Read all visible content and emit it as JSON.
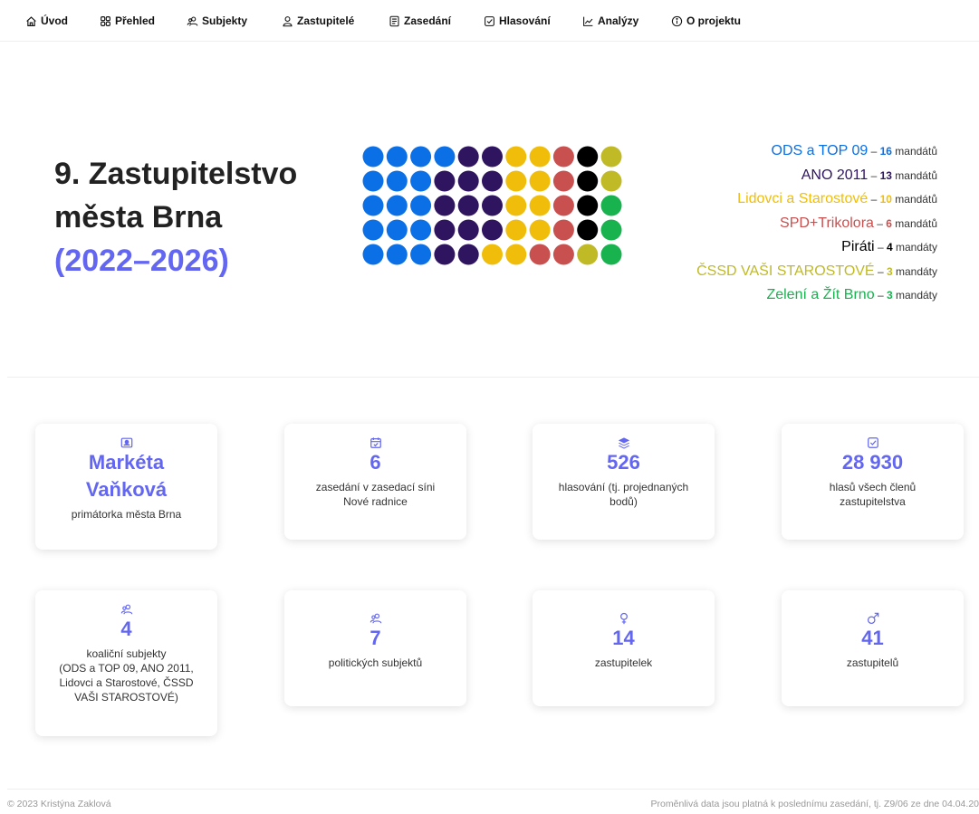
{
  "nav": {
    "items": [
      {
        "label": "Úvod",
        "icon": "home-icon"
      },
      {
        "label": "Přehled",
        "icon": "grid-icon"
      },
      {
        "label": "Subjekty",
        "icon": "users-icon"
      },
      {
        "label": "Zastupitelé",
        "icon": "user-icon"
      },
      {
        "label": "Zasedání",
        "icon": "document-icon"
      },
      {
        "label": "Hlasování",
        "icon": "checkbox-icon"
      },
      {
        "label": "Analýzy",
        "icon": "chart-icon"
      },
      {
        "label": "O projektu",
        "icon": "info-icon"
      }
    ]
  },
  "hero": {
    "title_line1": "9. Zastupitelstvo",
    "title_line2": "města Brna",
    "years": "(2022–2026)"
  },
  "parties": [
    {
      "name": "ODS a TOP 09",
      "dash": " – ",
      "count": "16",
      "unit": " mandátů",
      "color": "#0b6fe6"
    },
    {
      "name": "ANO 2011",
      "dash": " – ",
      "count": "13",
      "unit": " mandátů",
      "color": "#2f1460"
    },
    {
      "name": "Lidovci a Starostové",
      "dash": " – ",
      "count": "10",
      "unit": " mandátů",
      "color": "#f0be0a"
    },
    {
      "name": "SPD+Trikolora",
      "dash": " – ",
      "count": "6",
      "unit": " mandátů",
      "color": "#c8504f"
    },
    {
      "name": "Piráti",
      "dash": " – ",
      "count": "4",
      "unit": " mandáty",
      "color": "#000000"
    },
    {
      "name": "ČSSD VAŠI STAROSTOVÉ",
      "dash": " – ",
      "count": "3",
      "unit": " mandáty",
      "color": "#bfba25"
    },
    {
      "name": "Zelení a Žít Brno",
      "dash": " – ",
      "count": "3",
      "unit": " mandáty",
      "color": "#18b24f"
    }
  ],
  "cards": [
    {
      "icon": "id-card-icon",
      "value_line1": "Markéta",
      "value_line2": "Vaňková",
      "desc": "primátorka města Brna"
    },
    {
      "icon": "calendar-check-icon",
      "value": "6",
      "desc_line1": "zasedání v zasedací síni",
      "desc_line2": "Nové radnice"
    },
    {
      "icon": "layers-icon",
      "value": "526",
      "desc_line1": "hlasování (tj. projednaných",
      "desc_line2": "bodů)"
    },
    {
      "icon": "checkbox-icon",
      "value": "28 930",
      "desc_line1": "hlasů všech členů",
      "desc_line2": "zastupitelstva"
    },
    {
      "icon": "users-icon",
      "value": "4",
      "desc_line1": "koaliční subjekty",
      "desc_line2": "(ODS a TOP 09, ANO 2011,",
      "desc_line3": "Lidovci a Starostové, ČSSD",
      "desc_line4": "VAŠI STAROSTOVÉ)"
    },
    {
      "icon": "users-icon",
      "value": "7",
      "desc": "politických subjektů"
    },
    {
      "icon": "female-icon",
      "value": "14",
      "desc": "zastupitelek"
    },
    {
      "icon": "male-icon",
      "value": "41",
      "desc": "zastupitelů"
    }
  ],
  "footer": {
    "left": "© 2023 Kristýna Zaklová",
    "right": "Proměnlivá data jsou platná k poslednímu zasedání, tj. Z9/06 ze dne 04.04.20"
  },
  "colors": {
    "accent": "#6366f1"
  }
}
